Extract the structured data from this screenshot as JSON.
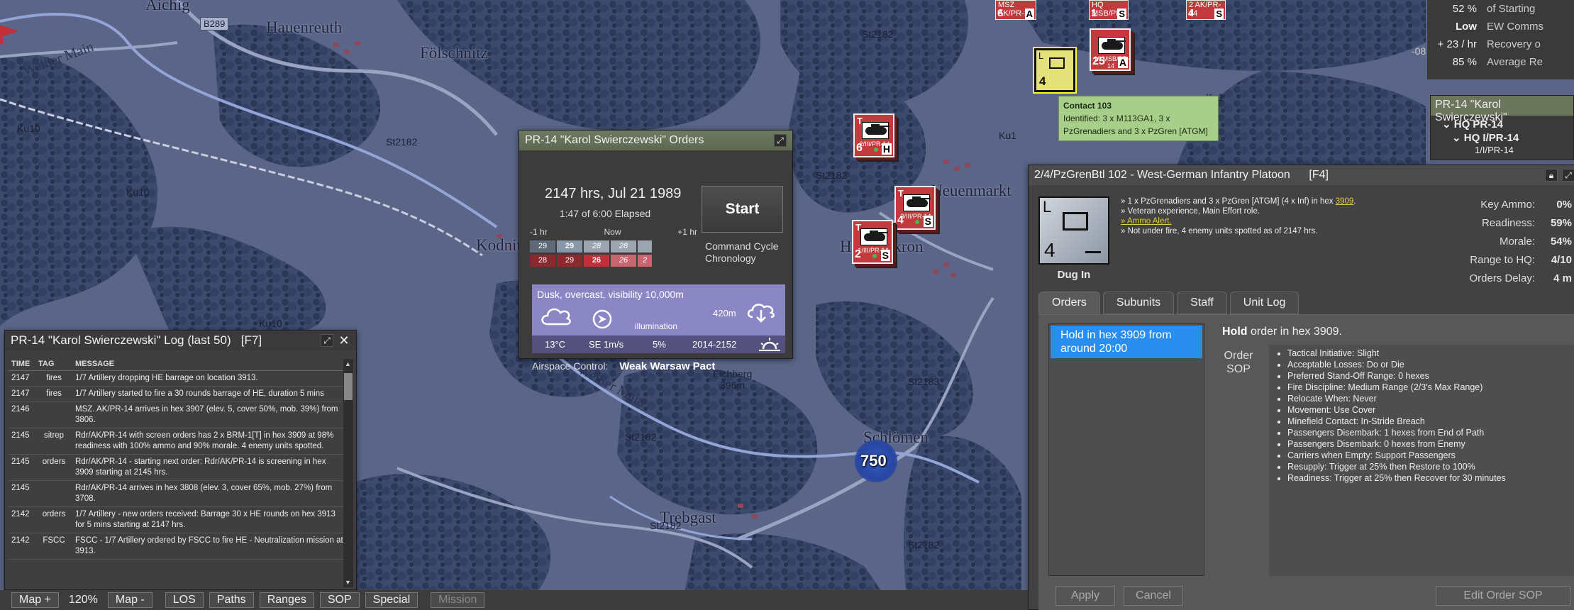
{
  "map": {
    "places": [
      "Aichig",
      "Hauenreuth",
      "Fölschnitz",
      "Neuenmarkt",
      "Kodnitz",
      "Himmelkron",
      "Schlömen",
      "Trebgast"
    ],
    "rivers": [
      "Weißer Main",
      "Weißer Main"
    ],
    "road": "B289",
    "hexes": [
      "Ku10",
      "Ku10",
      "Ku10",
      "Ku1",
      "Ku1",
      "St2182",
      "St2182",
      "St2182",
      "St2182",
      "St2183",
      "St2182",
      "St2182"
    ],
    "elevation": {
      "name": "Eichberg",
      "height": "396m"
    },
    "grid_mark": "-08",
    "target_value": "750",
    "tooltip": {
      "title": "Contact 103",
      "body": "Identified: 3 x M113GA1, 3 x PzGrenadiers and 3 x PzGren [ATGM]"
    },
    "counters": [
      {
        "type": "T",
        "id": "2/III/PR-14",
        "strength": "6",
        "level": "H"
      },
      {
        "type": "T",
        "id": "3/III/PR-14",
        "strength": "4",
        "level": "S"
      },
      {
        "type": "T",
        "id": "1/III/PR-14",
        "strength": "2",
        "level": "S"
      },
      {
        "type": "",
        "id": "1/I/MSB/PR-14",
        "strength": "25",
        "level": "A"
      }
    ],
    "top_counters": [
      {
        "id": "MSZ AK/PR-14",
        "strength": "6",
        "level": "A"
      },
      {
        "id": "HQ MSB/PR",
        "strength": "1",
        "level": "S"
      },
      {
        "id": "2 AK/PR-14",
        "strength": "4",
        "level": "S"
      }
    ],
    "selected_counter": {
      "strength": "4",
      "label": "L"
    }
  },
  "overview": {
    "rows": [
      {
        "value": "52 %",
        "label": "of Starting"
      },
      {
        "value": "Low",
        "label": "EW Comms"
      },
      {
        "value": "+ 23 / hr",
        "label": "Recovery o"
      },
      {
        "value": "85 %",
        "label": "Average Re"
      }
    ]
  },
  "oob": {
    "title": "PR-14 \"Karol Swierczewski\"",
    "items": [
      "HQ PR-14",
      "HQ I/PR-14",
      "1/I/PR-14"
    ]
  },
  "orders_window": {
    "title": "PR-14 \"Karol Swierczewski\" Orders",
    "time": "2147 hrs, Jul 21 1989",
    "elapsed": "1:47 of 6:00 Elapsed",
    "start_label": "Start",
    "cc_label_1": "Command Cycle",
    "cc_label_2": "Chronology",
    "timeline": {
      "left": "-1 hr",
      "mid": "Now",
      "right": "+1 hr",
      "row1": [
        "29",
        "29",
        "28",
        "28",
        ""
      ],
      "row2": [
        "28",
        "29",
        "26",
        "26",
        "2"
      ]
    },
    "weather": {
      "desc": "Dusk, overcast, visibility 10,000m",
      "illumination_label": "illumination",
      "cloud_base": "420m",
      "temp": "13°C",
      "wind": "SE 1m/s",
      "illumination": "5%",
      "daylight": "2014-2152"
    },
    "airspace_label": "Airspace Control:",
    "airspace_value": "Weak Warsaw Pact"
  },
  "log_window": {
    "title": "PR-14 \"Karol Swierczewski\" Log (last 50)   [F7]",
    "headers": [
      "TIME",
      "TAG",
      "MESSAGE"
    ],
    "rows": [
      {
        "time": "2147",
        "tag": "fires",
        "msg": "1/7 Artillery dropping HE barrage on location 3913."
      },
      {
        "time": "2147",
        "tag": "fires",
        "msg": "1/7 Artillery started to fire a 30 rounds barrage of HE, duration 5 mins"
      },
      {
        "time": "2146",
        "tag": "",
        "msg": "MSZ. AK/PR-14 arrives in hex 3907 (elev. 5, cover 50%, mob. 39%) from 3806."
      },
      {
        "time": "2145",
        "tag": "sitrep",
        "msg": "Rdr/AK/PR-14 with screen orders has 2 x BRM-1[T] in hex 3909 at 98% readiness with 100% ammo and 90% morale. 4 enemy units spotted."
      },
      {
        "time": "2145",
        "tag": "orders",
        "msg": "Rdr/AK/PR-14 - starting next order: Rdr/AK/PR-14 is screening in hex 3909 starting at 2145 hrs."
      },
      {
        "time": "2145",
        "tag": "",
        "msg": "Rdr/AK/PR-14 arrives in hex 3808 (elev. 3, cover 65%, mob. 27%) from 3708."
      },
      {
        "time": "2142",
        "tag": "orders",
        "msg": "1/7 Artillery - new orders received: Barrage 30 x HE rounds on hex 3913 for 5 mins starting at 2147 hrs."
      },
      {
        "time": "2142",
        "tag": "FSCC",
        "msg": "FSCC - 1/7 Artillery ordered by FSCC to fire HE - Neutralization mission at 3913."
      }
    ]
  },
  "unit_panel": {
    "title": "2/4/PzGrenBtl 102 - West-German Infantry Platoon      [F4]",
    "icon_label": "L",
    "icon_strength": "4",
    "state": "Dug In",
    "info_1": "» 1 x PzGrenadiers and 3 x PzGren [ATGM] (4 x Inf) in hex ",
    "info_1_hex": "3909",
    "info_2": "» Veteran experience, Main Effort role.",
    "info_3": "» Ammo Alert.",
    "info_4": "» Not under fire, 4 enemy units spotted as of 2147 hrs.",
    "stats": [
      {
        "label": "Key Ammo:",
        "value": "0%"
      },
      {
        "label": "Readiness:",
        "value": "59%"
      },
      {
        "label": "Morale:",
        "value": "54%"
      },
      {
        "label": "Range to HQ:",
        "value": "4/10"
      },
      {
        "label": "Orders Delay:",
        "value": "4 m"
      }
    ],
    "tabs": [
      "Orders",
      "Subunits",
      "Staff",
      "Unit Log"
    ],
    "order_item": "Hold in hex 3909 from around 20:00",
    "order_head_bold": "Hold",
    "order_head_rest": " order in hex 3909.",
    "sop_label": "Order SOP",
    "sop": [
      "Tactical Initiative: Slight",
      "Acceptable Losses: Do or Die",
      "Preferred Stand-Off Range: 0 hexes",
      "Fire Discipline: Medium Range (2/3's Max Range)",
      "Relocate When: Never",
      "Movement: Use Cover",
      "Minefield Contact: In-Stride Breach",
      "Passengers Disembark: 1 hexes from End of Path",
      "Passengers Disembark: 0 hexes from Enemy",
      "Carriers when Empty: Support Passengers",
      "Resupply: Trigger at 25% then Restore to 100%",
      "Readiness: Trigger at 25% then Recover for 30 minutes"
    ],
    "apply_label": "Apply",
    "cancel_label": "Cancel",
    "edit_sop_label": "Edit Order SOP"
  },
  "toolbar": {
    "map_plus": "Map +",
    "zoom": "120%",
    "map_minus": "Map -",
    "los": "LOS",
    "paths": "Paths",
    "ranges": "Ranges",
    "sop": "SOP",
    "special": "Special",
    "mission": "Mission"
  },
  "colors": {
    "accent_blue": "#2a8ef0",
    "titlebar_green": "#5d6850",
    "enemy_red": "#c23a3e",
    "map_base": "#4a5578"
  }
}
